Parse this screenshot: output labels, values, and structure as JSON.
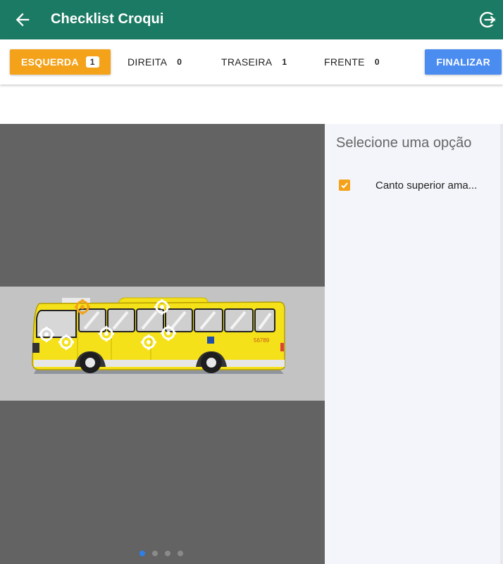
{
  "appbar": {
    "title": "Checklist Croqui",
    "back_icon": "arrow-left-icon",
    "exit_icon": "logout-icon"
  },
  "tabs": [
    {
      "label": "ESQUERDA",
      "count": "1",
      "active": true
    },
    {
      "label": "DIREITA",
      "count": "0",
      "active": false
    },
    {
      "label": "TRASEIRA",
      "count": "1",
      "active": false
    },
    {
      "label": "FRENTE",
      "count": "0",
      "active": false
    }
  ],
  "finish_label": "FINALIZAR",
  "panel": {
    "heading": "Selecione uma opção",
    "options": [
      {
        "label": "Canto superior ama...",
        "checked": true
      }
    ]
  },
  "bus": {
    "plate_text": "56789",
    "body_color": "#f5e11a",
    "marker_active_color": "#f3a21a"
  },
  "carousel": {
    "pages": 4,
    "current": 1
  },
  "colors": {
    "appbar": "#1b7a63",
    "active_tab": "#f3a21a",
    "finish": "#4a8cf0"
  }
}
